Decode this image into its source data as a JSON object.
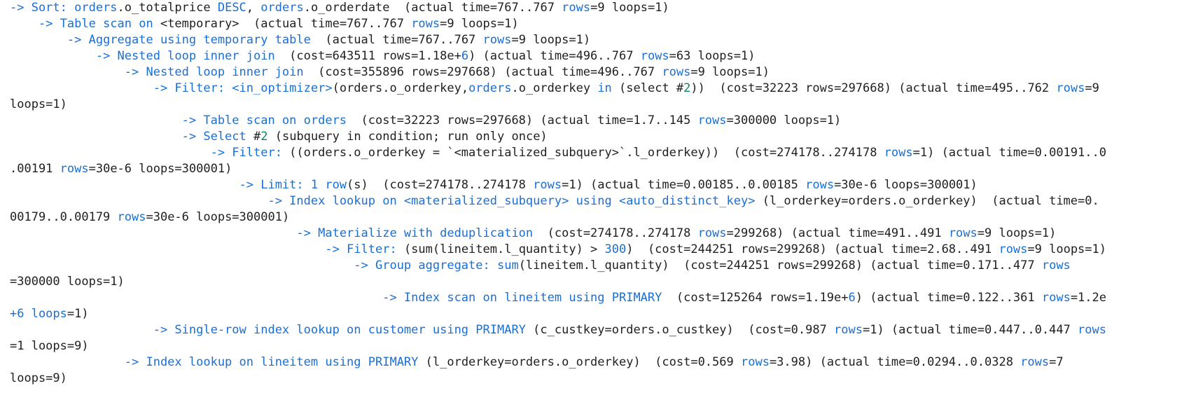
{
  "colors": {
    "keyword": "#1a6fd4",
    "number": "#098658",
    "text": "#1f1f1f",
    "background": "#ffffff"
  },
  "plan_lines": [
    [
      [
        "k",
        "-> Sort: "
      ],
      [
        "k",
        "orders"
      ],
      [
        "d",
        ".o_totalprice "
      ],
      [
        "k",
        "DESC"
      ],
      [
        "d",
        ", "
      ],
      [
        "k",
        "orders"
      ],
      [
        "d",
        ".o_orderdate  (actual time=767..767 "
      ],
      [
        "k",
        "rows"
      ],
      [
        "d",
        "=9 loops=1)"
      ]
    ],
    [
      [
        "d",
        "    "
      ],
      [
        "k",
        "-> Table scan on "
      ],
      [
        "d",
        "<temporary>  (actual time=767..767 "
      ],
      [
        "k",
        "rows"
      ],
      [
        "d",
        "=9 loops=1)"
      ]
    ],
    [
      [
        "d",
        "        "
      ],
      [
        "k",
        "-> Aggregate using temporary table"
      ],
      [
        "d",
        "  (actual time=767..767 "
      ],
      [
        "k",
        "rows"
      ],
      [
        "d",
        "=9 loops=1)"
      ]
    ],
    [
      [
        "d",
        "            "
      ],
      [
        "k",
        "-> Nested loop inner join"
      ],
      [
        "d",
        "  (cost=643511 rows=1.18e+"
      ],
      [
        "k",
        "6"
      ],
      [
        "d",
        ") (actual time=496..767 "
      ],
      [
        "k",
        "rows"
      ],
      [
        "d",
        "=63 loops=1)"
      ]
    ],
    [
      [
        "d",
        "                "
      ],
      [
        "k",
        "-> Nested loop inner join"
      ],
      [
        "d",
        "  (cost=355896 rows=297668) (actual time=496..767 "
      ],
      [
        "k",
        "rows"
      ],
      [
        "d",
        "=9 loops=1)"
      ]
    ],
    [
      [
        "d",
        "                    "
      ],
      [
        "k",
        "-> Filter: "
      ],
      [
        "k",
        "<in_optimizer>"
      ],
      [
        "d",
        "(orders.o_orderkey,"
      ],
      [
        "k",
        "orders"
      ],
      [
        "d",
        ".o_orderkey "
      ],
      [
        "k",
        "in"
      ],
      [
        "d",
        " (select #"
      ],
      [
        "g",
        "2"
      ],
      [
        "d",
        "))  (cost=32223 rows=297668) (actual time=495..762 "
      ],
      [
        "k",
        "rows"
      ],
      [
        "d",
        "=9"
      ]
    ],
    [
      [
        "d",
        "loops=1)"
      ]
    ],
    [
      [
        "d",
        "                        "
      ],
      [
        "k",
        "-> Table scan on orders"
      ],
      [
        "d",
        "  (cost=32223 rows=297668) (actual time=1.7..145 "
      ],
      [
        "k",
        "rows"
      ],
      [
        "d",
        "=300000 loops=1)"
      ]
    ],
    [
      [
        "d",
        "                        "
      ],
      [
        "k",
        "-> Select "
      ],
      [
        "d",
        "#"
      ],
      [
        "g",
        "2"
      ],
      [
        "d",
        " (subquery in condition; run only once)"
      ]
    ],
    [
      [
        "d",
        "                            "
      ],
      [
        "k",
        "-> Filter: "
      ],
      [
        "d",
        "((orders.o_orderkey = `<materialized_subquery>`.l_orderkey))  (cost=274178..274178 "
      ],
      [
        "k",
        "rows"
      ],
      [
        "d",
        "=1) (actual time=0.00191..0"
      ]
    ],
    [
      [
        "d",
        ".00191 "
      ],
      [
        "k",
        "rows"
      ],
      [
        "d",
        "=30e-6 loops=300001)"
      ]
    ],
    [
      [
        "d",
        "                                "
      ],
      [
        "k",
        "-> Limit: 1 row"
      ],
      [
        "d",
        "(s)  (cost=274178..274178 "
      ],
      [
        "k",
        "rows"
      ],
      [
        "d",
        "=1) (actual time=0.00185..0.00185 "
      ],
      [
        "k",
        "rows"
      ],
      [
        "d",
        "=30e-6 loops=300001)"
      ]
    ],
    [
      [
        "d",
        "                                    "
      ],
      [
        "k",
        "-> Index lookup on <materialized_subquery> using <auto_distinct_key>"
      ],
      [
        "d",
        " (l_orderkey=orders.o_orderkey)  (actual time=0."
      ]
    ],
    [
      [
        "d",
        "00179..0.00179 "
      ],
      [
        "k",
        "rows"
      ],
      [
        "d",
        "=30e-6 loops=300001)"
      ]
    ],
    [
      [
        "d",
        "                                        "
      ],
      [
        "k",
        "-> Materialize with deduplication"
      ],
      [
        "d",
        "  (cost=274178..274178 "
      ],
      [
        "k",
        "rows"
      ],
      [
        "d",
        "=299268) (actual time=491..491 "
      ],
      [
        "k",
        "rows"
      ],
      [
        "d",
        "=9 loops=1)"
      ]
    ],
    [
      [
        "d",
        "                                            "
      ],
      [
        "k",
        "-> Filter: "
      ],
      [
        "d",
        "(sum(lineitem.l_quantity) > "
      ],
      [
        "k",
        "300"
      ],
      [
        "d",
        ")  (cost=244251 rows=299268) (actual time=2.68..491 "
      ],
      [
        "k",
        "rows"
      ],
      [
        "d",
        "=9 loops=1)"
      ]
    ],
    [
      [
        "d",
        "                                                "
      ],
      [
        "k",
        "-> Group aggregate: sum"
      ],
      [
        "d",
        "(lineitem.l_quantity)  (cost=244251 rows=299268) (actual time=0.171..477 "
      ],
      [
        "k",
        "rows"
      ]
    ],
    [
      [
        "d",
        "=300000 loops=1)"
      ]
    ],
    [
      [
        "d",
        "                                                    "
      ],
      [
        "k",
        "-> Index scan on lineitem using PRIMARY"
      ],
      [
        "d",
        "  (cost=125264 rows=1.19e+"
      ],
      [
        "k",
        "6"
      ],
      [
        "d",
        ") (actual time=0.122..361 "
      ],
      [
        "k",
        "rows"
      ],
      [
        "d",
        "=1.2e"
      ]
    ],
    [
      [
        "k",
        "+6 loops"
      ],
      [
        "d",
        "=1)"
      ]
    ],
    [
      [
        "d",
        "                    "
      ],
      [
        "k",
        "-> Single-row index lookup on customer using PRIMARY"
      ],
      [
        "d",
        " (c_custkey=orders.o_custkey)  (cost=0.987 "
      ],
      [
        "k",
        "rows"
      ],
      [
        "d",
        "=1) (actual time=0.447..0.447 "
      ],
      [
        "k",
        "rows"
      ]
    ],
    [
      [
        "d",
        "=1 loops=9)"
      ]
    ],
    [
      [
        "d",
        "                "
      ],
      [
        "k",
        "-> Index lookup on lineitem using PRIMARY"
      ],
      [
        "d",
        " (l_orderkey=orders.o_orderkey)  (cost=0.569 "
      ],
      [
        "k",
        "rows"
      ],
      [
        "d",
        "=3.98) (actual time=0.0294..0.0328 "
      ],
      [
        "k",
        "rows"
      ],
      [
        "d",
        "=7"
      ]
    ],
    [
      [
        "d",
        "loops=9)"
      ]
    ]
  ]
}
